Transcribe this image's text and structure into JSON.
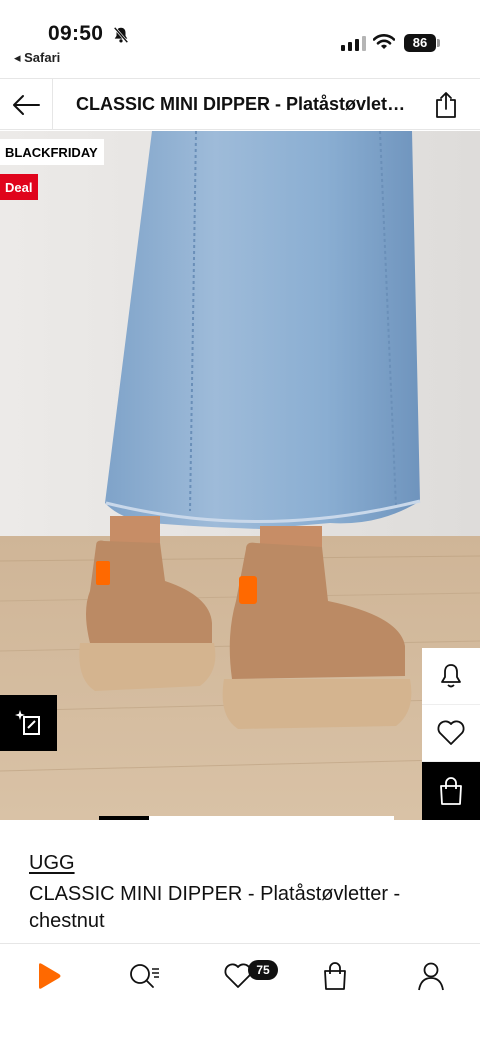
{
  "status_bar": {
    "time": "09:50",
    "back_app": "◂ Safari",
    "battery": "86"
  },
  "header": {
    "title": "CLASSIC MINI DIPPER - Platåstøvletter - chestnut"
  },
  "gallery": {
    "badges": {
      "black_friday": "BLACKFRIDAY",
      "deal": "Deal"
    },
    "progress_fraction": 0.17
  },
  "product": {
    "brand": "UGG",
    "name": "CLASSIC MINI DIPPER - Platåstøvletter - chestnut"
  },
  "tabbar": {
    "wishlist_count": "75",
    "tabs": [
      "home-icon",
      "search-icon",
      "heart-icon",
      "bag-icon",
      "profile-icon"
    ]
  },
  "colors": {
    "deal_red": "#e0041c",
    "brand_orange": "#ff6900",
    "boot_chestnut": "#bb8a64"
  }
}
